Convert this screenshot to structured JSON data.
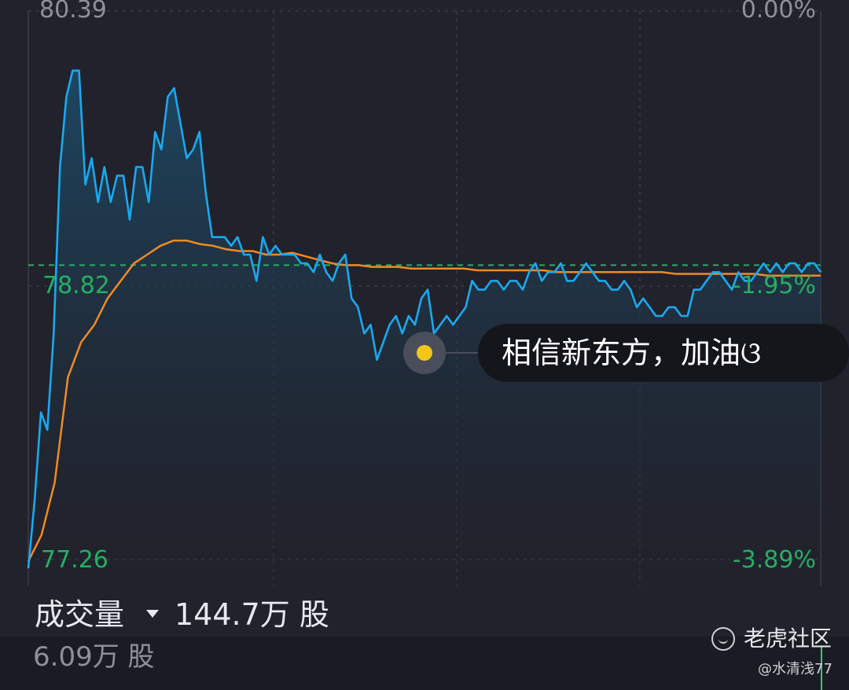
{
  "chart_data": {
    "type": "line",
    "series": [
      {
        "role": "price",
        "color": "#1aa9f0",
        "values": [
          77.21,
          77.6,
          78.1,
          78.0,
          78.55,
          79.5,
          79.9,
          80.05,
          80.05,
          79.4,
          79.55,
          79.3,
          79.5,
          79.3,
          79.45,
          79.45,
          79.2,
          79.5,
          79.5,
          79.3,
          79.7,
          79.6,
          79.9,
          79.95,
          79.75,
          79.55,
          79.6,
          79.7,
          79.35,
          79.1,
          79.1,
          79.1,
          79.05,
          79.1,
          79.0,
          79.0,
          78.85,
          79.1,
          79.0,
          79.05,
          79.0,
          79.0,
          79.0,
          78.95,
          78.95,
          78.9,
          79.0,
          78.9,
          78.85,
          78.95,
          79.0,
          78.75,
          78.7,
          78.55,
          78.6,
          78.4,
          78.5,
          78.6,
          78.65,
          78.55,
          78.65,
          78.6,
          78.75,
          78.8,
          78.55,
          78.6,
          78.65,
          78.6,
          78.65,
          78.7,
          78.85,
          78.8,
          78.8,
          78.85,
          78.85,
          78.8,
          78.85,
          78.85,
          78.8,
          78.9,
          78.95,
          78.85,
          78.9,
          78.9,
          78.95,
          78.85,
          78.85,
          78.9,
          78.95,
          78.9,
          78.85,
          78.85,
          78.8,
          78.8,
          78.85,
          78.8,
          78.7,
          78.75,
          78.7,
          78.65,
          78.65,
          78.7,
          78.7,
          78.65,
          78.65,
          78.8,
          78.8,
          78.85,
          78.9,
          78.9,
          78.85,
          78.8,
          78.9,
          78.85,
          78.85,
          78.9,
          78.95,
          78.9,
          78.95,
          78.9,
          78.95,
          78.95,
          78.9,
          78.95,
          78.95,
          78.9
        ],
        "name": ""
      },
      {
        "role": "average",
        "color": "#f08a24",
        "values": [
          77.25,
          77.4,
          77.7,
          78.3,
          78.5,
          78.6,
          78.75,
          78.85,
          78.95,
          79.0,
          79.05,
          79.08,
          79.08,
          79.06,
          79.05,
          79.03,
          79.02,
          79.02,
          79.0,
          79.0,
          79.01,
          78.99,
          78.97,
          78.95,
          78.94,
          78.94,
          78.93,
          78.93,
          78.93,
          78.92,
          78.92,
          78.92,
          78.92,
          78.92,
          78.91,
          78.91,
          78.91,
          78.91,
          78.91,
          78.91,
          78.9,
          78.9,
          78.9,
          78.9,
          78.9,
          78.9,
          78.9,
          78.9,
          78.9,
          78.89,
          78.89,
          78.89,
          78.89,
          78.89,
          78.89,
          78.89,
          78.88,
          78.88,
          78.88,
          78.88,
          78.88
        ],
        "name": ""
      }
    ],
    "ylim": [
      77.26,
      80.39
    ],
    "reference_price": 80.39,
    "y_ticks_left": [
      "80.39",
      "78.82",
      "77.26"
    ],
    "y_ticks_right": [
      "0.00%",
      "-1.95%",
      "-3.89%"
    ],
    "grid": true,
    "title": "",
    "xlabel": "",
    "ylabel": ""
  },
  "comment": {
    "text": "相信新东方，加油ଓ"
  },
  "volume": {
    "label": "成交量",
    "total": "144.7万 股",
    "max": "6.09万 股"
  },
  "watermark": {
    "brand": "老虎社区",
    "user": "@水清浅77"
  },
  "colors": {
    "background": "#21222b",
    "price_line": "#1aa9f0",
    "average_line": "#f08a24",
    "down": "#27ae63",
    "reference_line": "#27ae63"
  }
}
